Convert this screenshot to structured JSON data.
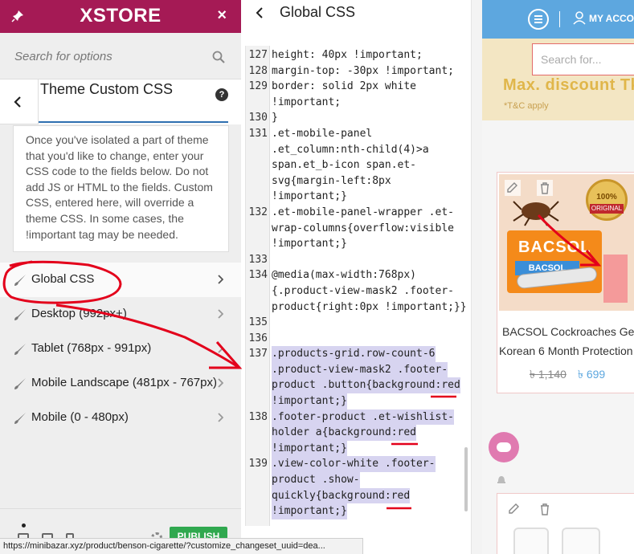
{
  "panel": {
    "logo": "XSTORE",
    "search_placeholder": "Search for options",
    "section_title": "Theme Custom CSS",
    "help": "?",
    "description": "Once you've isolated a part of theme that you'd like to change, enter your CSS code to the fields below. Do not add JS or HTML to the fields. Custom CSS, entered here, will override a theme CSS. In some cases, the !important tag may be needed.",
    "menu": [
      {
        "label": "Global CSS"
      },
      {
        "label": "Desktop (992px+)"
      },
      {
        "label": "Tablet (768px - 991px)"
      },
      {
        "label": "Mobile Landscape (481px - 767px)"
      },
      {
        "label": "Mobile (0 - 480px)"
      }
    ],
    "publish_label": "PUBLISH"
  },
  "editor": {
    "title": "Global CSS",
    "lines": [
      {
        "n": "127",
        "t": "height: 40px !important;"
      },
      {
        "n": "128",
        "t": "margin-top: -30px !important;"
      },
      {
        "n": "129",
        "t": "border: solid 2px white"
      },
      {
        "n": "",
        "t": "!important;"
      },
      {
        "n": "130",
        "t": "}"
      },
      {
        "n": "131",
        "t": ".et-mobile-panel"
      },
      {
        "n": "",
        "t": ".et_column:nth-child(4)>a"
      },
      {
        "n": "",
        "t": "span.et_b-icon span.et-"
      },
      {
        "n": "",
        "t": "svg{margin-left:8px"
      },
      {
        "n": "",
        "t": "!important;}"
      },
      {
        "n": "132",
        "t": ".et-mobile-panel-wrapper .et-"
      },
      {
        "n": "",
        "t": "wrap-columns{overflow:visible"
      },
      {
        "n": "",
        "t": "!important;}"
      },
      {
        "n": "133",
        "t": ""
      },
      {
        "n": "134",
        "t": "@media(max-width:768px)"
      },
      {
        "n": "",
        "t": "{.product-view-mask2 .footer-"
      },
      {
        "n": "",
        "t": "product{right:0px !important;}}"
      },
      {
        "n": "135",
        "t": ""
      },
      {
        "n": "136",
        "t": ""
      },
      {
        "n": "137",
        "t": ".products-grid.row-count-6",
        "hl": true
      },
      {
        "n": "",
        "t": ".product-view-mask2 .footer-",
        "hl": true
      },
      {
        "n": "",
        "t": "product .button{background:red",
        "hl": true
      },
      {
        "n": "",
        "t": "!important;}",
        "hl": true
      },
      {
        "n": "138",
        "t": ".footer-product .et-wishlist-",
        "hl": true
      },
      {
        "n": "",
        "t": "holder a{background:red",
        "hl": true
      },
      {
        "n": "",
        "t": "!important;}",
        "hl": true
      },
      {
        "n": "139",
        "t": ".view-color-white .footer-",
        "hl": true
      },
      {
        "n": "",
        "t": "product .show-",
        "hl": true
      },
      {
        "n": "",
        "t": "quickly{background:red",
        "hl": true
      },
      {
        "n": "",
        "t": "!important;}",
        "hl": true
      }
    ]
  },
  "site": {
    "account_label": "MY ACCO",
    "search_placeholder": "Search for...",
    "promo_title": "Max. discount Tk",
    "promo_note": "*T&C apply",
    "product_name_1": "BACSOL Cockroaches Gel",
    "product_name_2": "Korean 6 Month Protection",
    "price_old": "৳ 1,140",
    "price_new": "৳ 699",
    "package_brand": "BACSOL",
    "package_brand_sub": "BACSOL",
    "badge_pct": "100%",
    "badge_orig": "ORIGINAL"
  },
  "status_url": "https://minibazar.xyz/product/benson-cigarette/?customize_changeset_uuid=dea...",
  "colors": {
    "brand": "#a51a55",
    "accent_blue": "#5da7df",
    "annotation_red": "#e3001b",
    "publish_green": "#30a84f"
  }
}
